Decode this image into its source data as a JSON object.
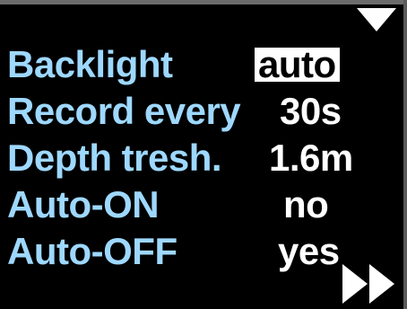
{
  "settings": {
    "items": [
      {
        "label": "Backlight",
        "value": "auto",
        "selected": true
      },
      {
        "label": "Record every",
        "value": "30s",
        "selected": false
      },
      {
        "label": "Depth tresh.",
        "value": "1.6m",
        "selected": false
      },
      {
        "label": "Auto-ON",
        "value": "no",
        "selected": false
      },
      {
        "label": "Auto-OFF",
        "value": "yes",
        "selected": false
      }
    ]
  },
  "navigation": {
    "down_icon": "triangle-down-icon",
    "next_icon": "double-chevron-right-icon"
  },
  "colors": {
    "background": "#000000",
    "label": "#9ed8ff",
    "value": "#ffffff",
    "selected_bg": "#ffffff",
    "selected_text": "#000000"
  }
}
